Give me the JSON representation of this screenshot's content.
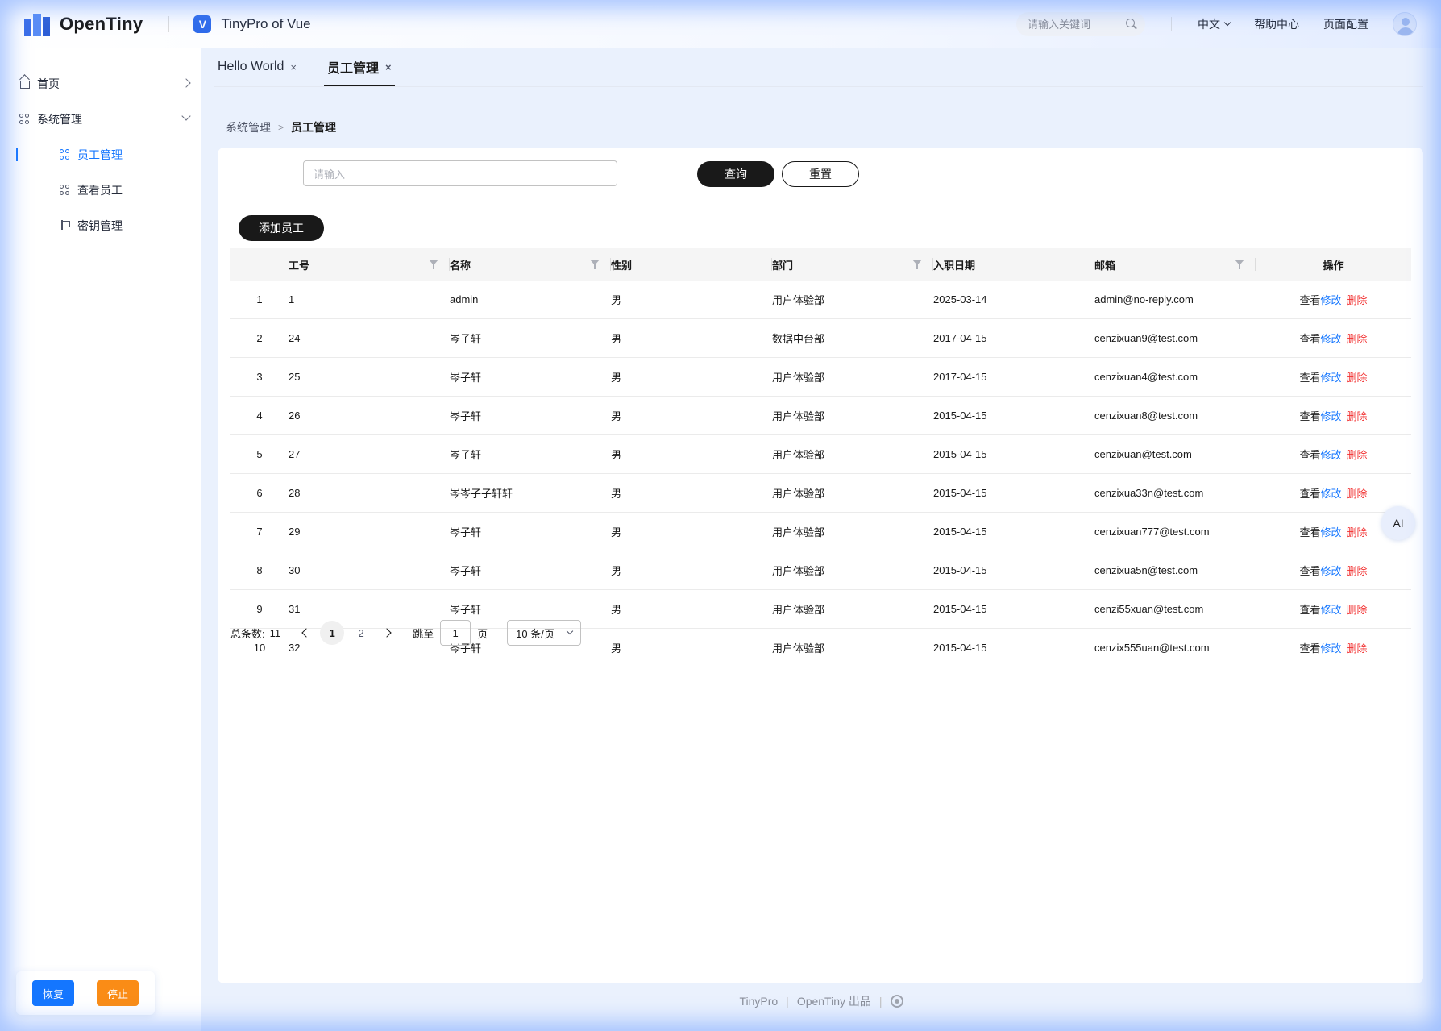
{
  "header": {
    "brand": "OpenTiny",
    "app_badge": "V",
    "app_name": "TinyPro of Vue",
    "search_placeholder": "请输入关键词",
    "language": "中文",
    "help": "帮助中心",
    "page_config": "页面配置"
  },
  "sidebar": {
    "items": [
      {
        "label": "首页",
        "icon": "home-icon"
      },
      {
        "label": "系统管理",
        "icon": "grid-icon"
      },
      {
        "label": "员工管理",
        "icon": "grid-icon",
        "active": true
      },
      {
        "label": "查看员工",
        "icon": "grid-icon"
      },
      {
        "label": "密钥管理",
        "icon": "flag-icon"
      }
    ],
    "restore_label": "恢复",
    "stop_label": "停止"
  },
  "tabs": [
    {
      "label": "Hello World",
      "close": "×"
    },
    {
      "label": "员工管理",
      "close": "×",
      "active": true
    }
  ],
  "breadcrumb": {
    "parent": "系统管理",
    "separator": ">",
    "current": "员工管理"
  },
  "filters": {
    "input_placeholder": "请输入",
    "query_label": "查询",
    "reset_label": "重置",
    "add_label": "添加员工"
  },
  "table": {
    "columns": [
      "工号",
      "名称",
      "性别",
      "部门",
      "入职日期",
      "邮箱",
      "操作"
    ],
    "ops": {
      "view": "查看",
      "edit": "修改",
      "delete": "删除"
    },
    "rows": [
      {
        "idx": "1",
        "id": "1",
        "name": "admin",
        "gender": "男",
        "dept": "用户体验部",
        "date": "2025-03-14",
        "email": "admin@no-reply.com"
      },
      {
        "idx": "2",
        "id": "24",
        "name": "岑子轩",
        "gender": "男",
        "dept": "数据中台部",
        "date": "2017-04-15",
        "email": "cenzixuan9@test.com"
      },
      {
        "idx": "3",
        "id": "25",
        "name": "岑子轩",
        "gender": "男",
        "dept": "用户体验部",
        "date": "2017-04-15",
        "email": "cenzixuan4@test.com"
      },
      {
        "idx": "4",
        "id": "26",
        "name": "岑子轩",
        "gender": "男",
        "dept": "用户体验部",
        "date": "2015-04-15",
        "email": "cenzixuan8@test.com"
      },
      {
        "idx": "5",
        "id": "27",
        "name": "岑子轩",
        "gender": "男",
        "dept": "用户体验部",
        "date": "2015-04-15",
        "email": "cenzixuan@test.com"
      },
      {
        "idx": "6",
        "id": "28",
        "name": "岑岑子子轩轩",
        "gender": "男",
        "dept": "用户体验部",
        "date": "2015-04-15",
        "email": "cenzixua33n@test.com"
      },
      {
        "idx": "7",
        "id": "29",
        "name": "岑子轩",
        "gender": "男",
        "dept": "用户体验部",
        "date": "2015-04-15",
        "email": "cenzixuan777@test.com"
      },
      {
        "idx": "8",
        "id": "30",
        "name": "岑子轩",
        "gender": "男",
        "dept": "用户体验部",
        "date": "2015-04-15",
        "email": "cenzixua5n@test.com"
      },
      {
        "idx": "9",
        "id": "31",
        "name": "岑子轩",
        "gender": "男",
        "dept": "用户体验部",
        "date": "2015-04-15",
        "email": "cenzi55xuan@test.com"
      },
      {
        "idx": "10",
        "id": "32",
        "name": "岑子轩",
        "gender": "男",
        "dept": "用户体验部",
        "date": "2015-04-15",
        "email": "cenzix555uan@test.com"
      }
    ]
  },
  "pagination": {
    "total_label": "总条数:",
    "total": "11",
    "pages": [
      "1",
      "2"
    ],
    "current_page": "1",
    "goto_label": "跳至",
    "goto_value": "1",
    "page_unit": "页",
    "page_size": "10 条/页"
  },
  "footer": {
    "left": "TinyPro",
    "right": "OpenTiny 出品",
    "sep": "|"
  },
  "ai_label": "AI",
  "colors": {
    "accent": "#1476ff",
    "danger": "#f23030",
    "warning": "#fa8c16",
    "primary_dark": "#191919"
  }
}
